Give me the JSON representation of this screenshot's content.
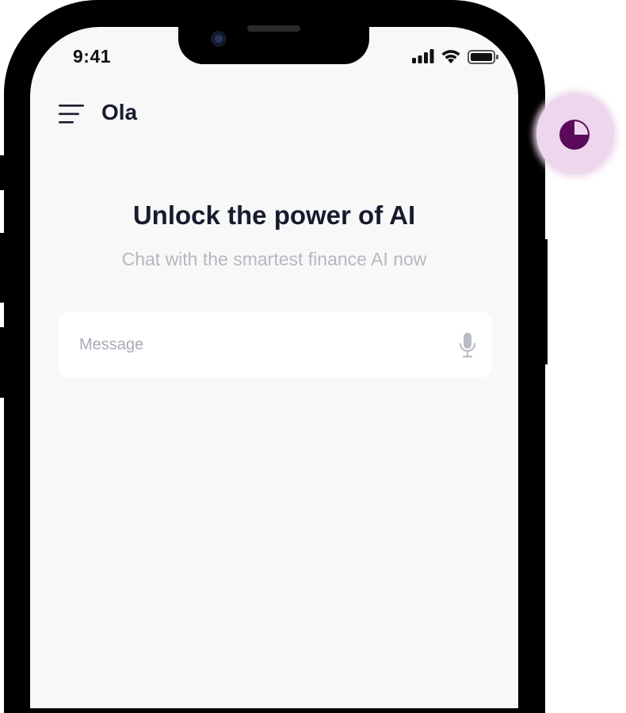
{
  "status_bar": {
    "time": "9:41",
    "icons": [
      "cellular-signal-icon",
      "wifi-icon",
      "battery-icon"
    ]
  },
  "header": {
    "menu_icon": "hamburger-menu-icon",
    "app_name": "Ola"
  },
  "hero": {
    "title": "Unlock the power of AI",
    "subtitle": "Chat with the smartest finance AI now"
  },
  "composer": {
    "placeholder": "Message",
    "value": "",
    "mic_icon": "microphone-icon"
  },
  "touch_indicator": {
    "icon": "touch-indicator-icon",
    "color": "#5b0a5a",
    "halo_color": "#eed7ec"
  },
  "colors": {
    "screen_bg": "#f8f8f8",
    "text_primary": "#171b2e",
    "text_secondary": "#b4b8bf"
  }
}
